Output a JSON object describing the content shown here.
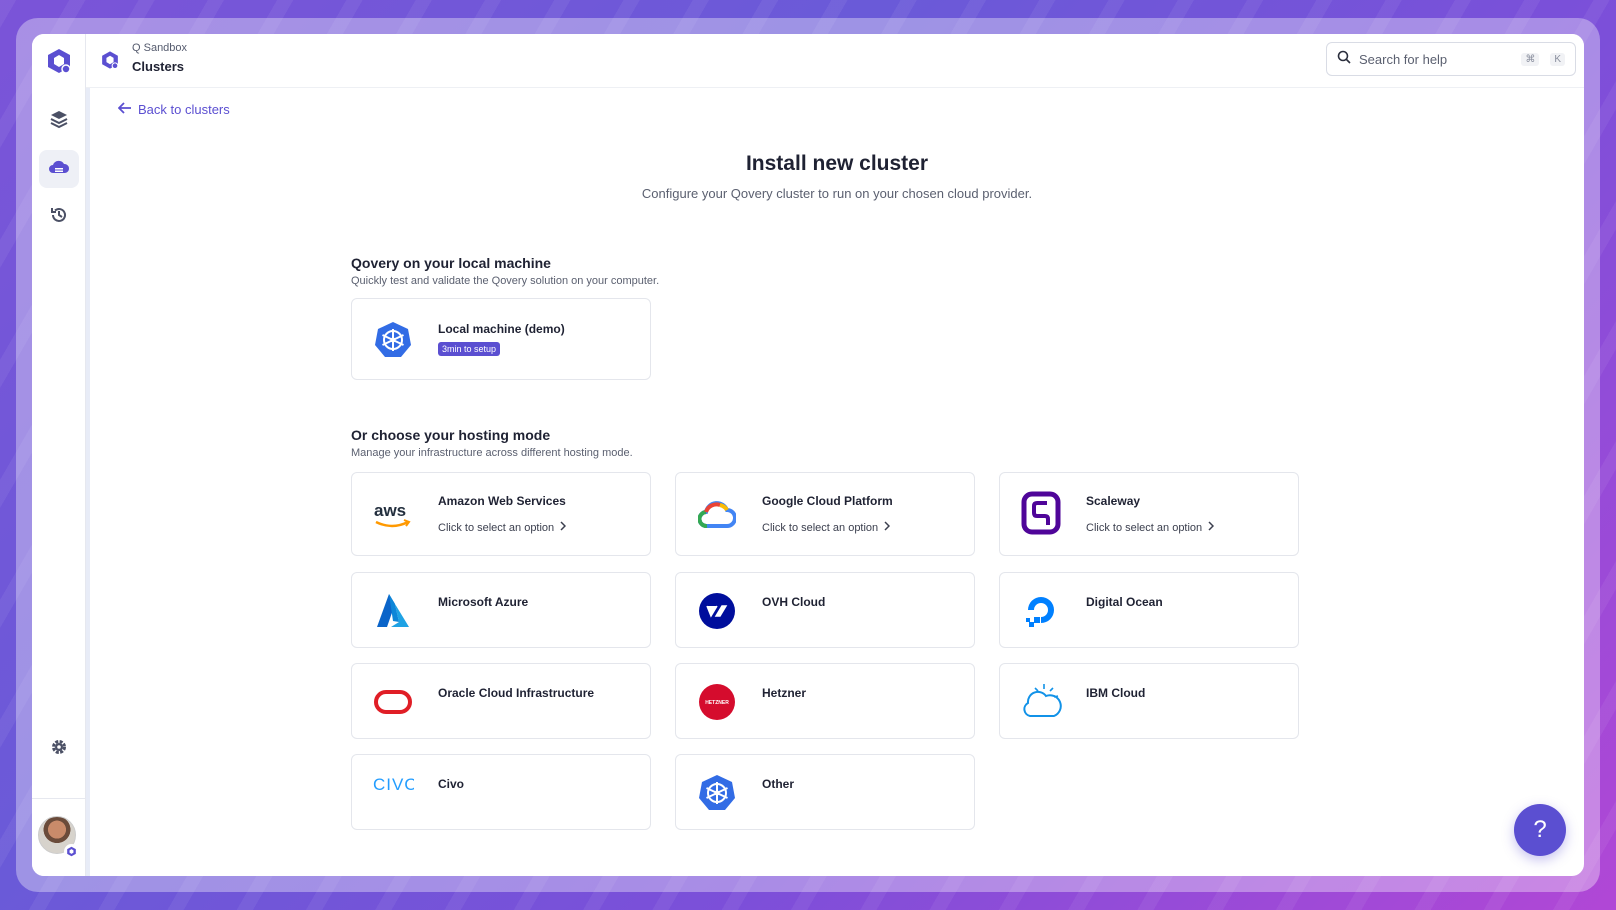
{
  "header": {
    "org_name": "Q Sandbox",
    "page_name": "Clusters",
    "search": {
      "placeholder": "Search for help",
      "shortcut_mod": "⌘",
      "shortcut_key": "K"
    }
  },
  "sidebar": {
    "items": [
      {
        "name": "layers-icon"
      },
      {
        "name": "cloud-icon",
        "active": true
      },
      {
        "name": "history-icon"
      },
      {
        "name": "settings-icon"
      }
    ]
  },
  "back_link": "Back to clusters",
  "page": {
    "title": "Install new cluster",
    "subtitle": "Configure your Qovery cluster to run on your chosen cloud provider."
  },
  "local_section": {
    "title": "Qovery on your local machine",
    "subtitle": "Quickly test and validate the Qovery solution on your computer.",
    "card": {
      "name": "Local machine (demo)",
      "badge": "3min to setup",
      "logo": "kubernetes-icon"
    }
  },
  "hosting_section": {
    "title": "Or choose your hosting mode",
    "subtitle": "Manage your infrastructure across different hosting mode.",
    "option_label": "Click to select an option",
    "providers": [
      {
        "name": "Amazon Web Services",
        "logo": "aws-logo",
        "has_options": true
      },
      {
        "name": "Google Cloud Platform",
        "logo": "gcp-logo",
        "has_options": true
      },
      {
        "name": "Scaleway",
        "logo": "scaleway-logo",
        "has_options": true
      },
      {
        "name": "Microsoft Azure",
        "logo": "azure-logo"
      },
      {
        "name": "OVH Cloud",
        "logo": "ovh-logo"
      },
      {
        "name": "Digital Ocean",
        "logo": "digitalocean-logo"
      },
      {
        "name": "Oracle Cloud Infrastructure",
        "logo": "oracle-logo"
      },
      {
        "name": "Hetzner",
        "logo": "hetzner-logo"
      },
      {
        "name": "IBM Cloud",
        "logo": "ibm-cloud-logo"
      },
      {
        "name": "Civo",
        "logo": "civo-logo"
      },
      {
        "name": "Other",
        "logo": "kubernetes-icon"
      }
    ]
  },
  "logo_text": {
    "aws": "aws",
    "civo": "CIVO",
    "hetzner": "HETZNER"
  },
  "help_button": "?",
  "colors": {
    "accent": "#5b4fd1",
    "text": "#1f2233"
  }
}
